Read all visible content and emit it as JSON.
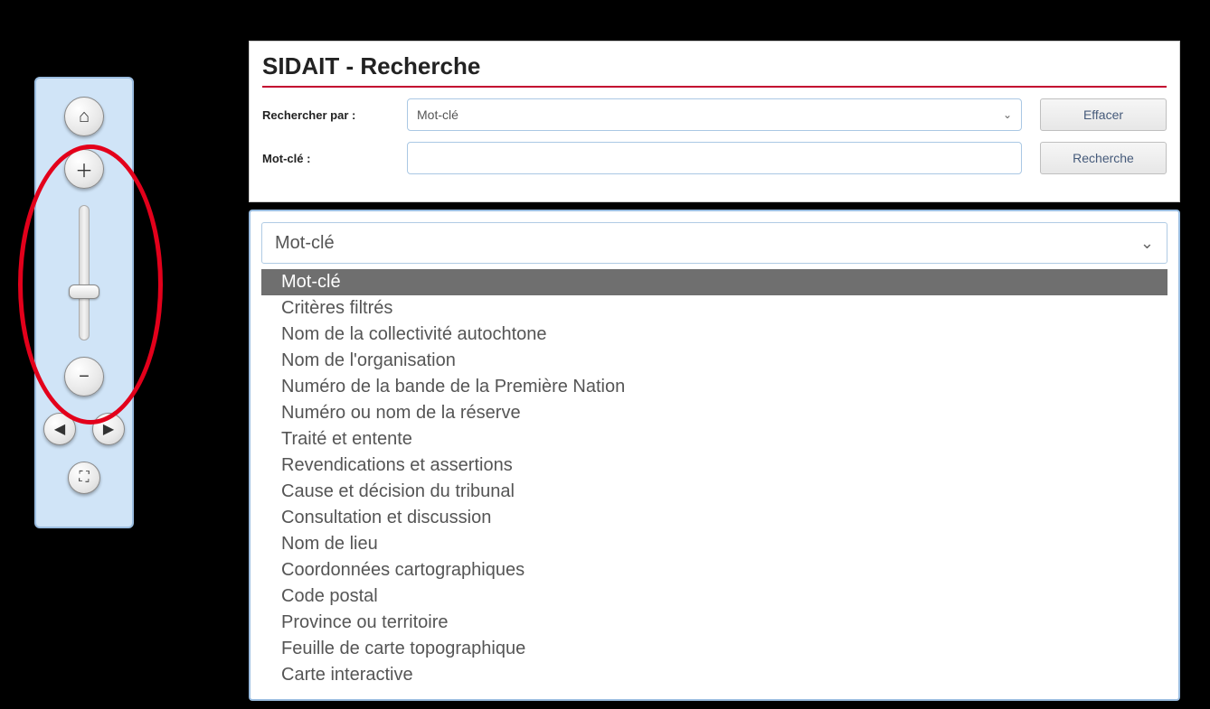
{
  "zoom": {
    "home_icon": "⌂",
    "plus_icon": "＋",
    "minus_icon": "−",
    "prev_icon": "◀",
    "next_icon": "▶",
    "extent_icon": "⛶"
  },
  "search_panel": {
    "title": "SIDAIT - Recherche",
    "label_search_by": "Rechercher par :",
    "label_keyword": "Mot-clé :",
    "select_value": "Mot-clé",
    "input_value": "",
    "btn_clear": "Effacer",
    "btn_search": "Recherche"
  },
  "dropdown": {
    "current": "Mot-clé",
    "options": [
      "Mot-clé",
      "Critères filtrés",
      "Nom de la collectivité autochtone",
      "Nom de l'organisation",
      "Numéro de la bande de la Première Nation",
      "Numéro ou nom de la réserve",
      "Traité et entente",
      "Revendications et assertions",
      "Cause et décision du tribunal",
      "Consultation et discussion",
      "Nom de lieu",
      "Coordonnées cartographiques",
      "Code postal",
      "Province ou territoire",
      "Feuille de carte topographique",
      "Carte interactive"
    ],
    "selected_index": 0
  }
}
